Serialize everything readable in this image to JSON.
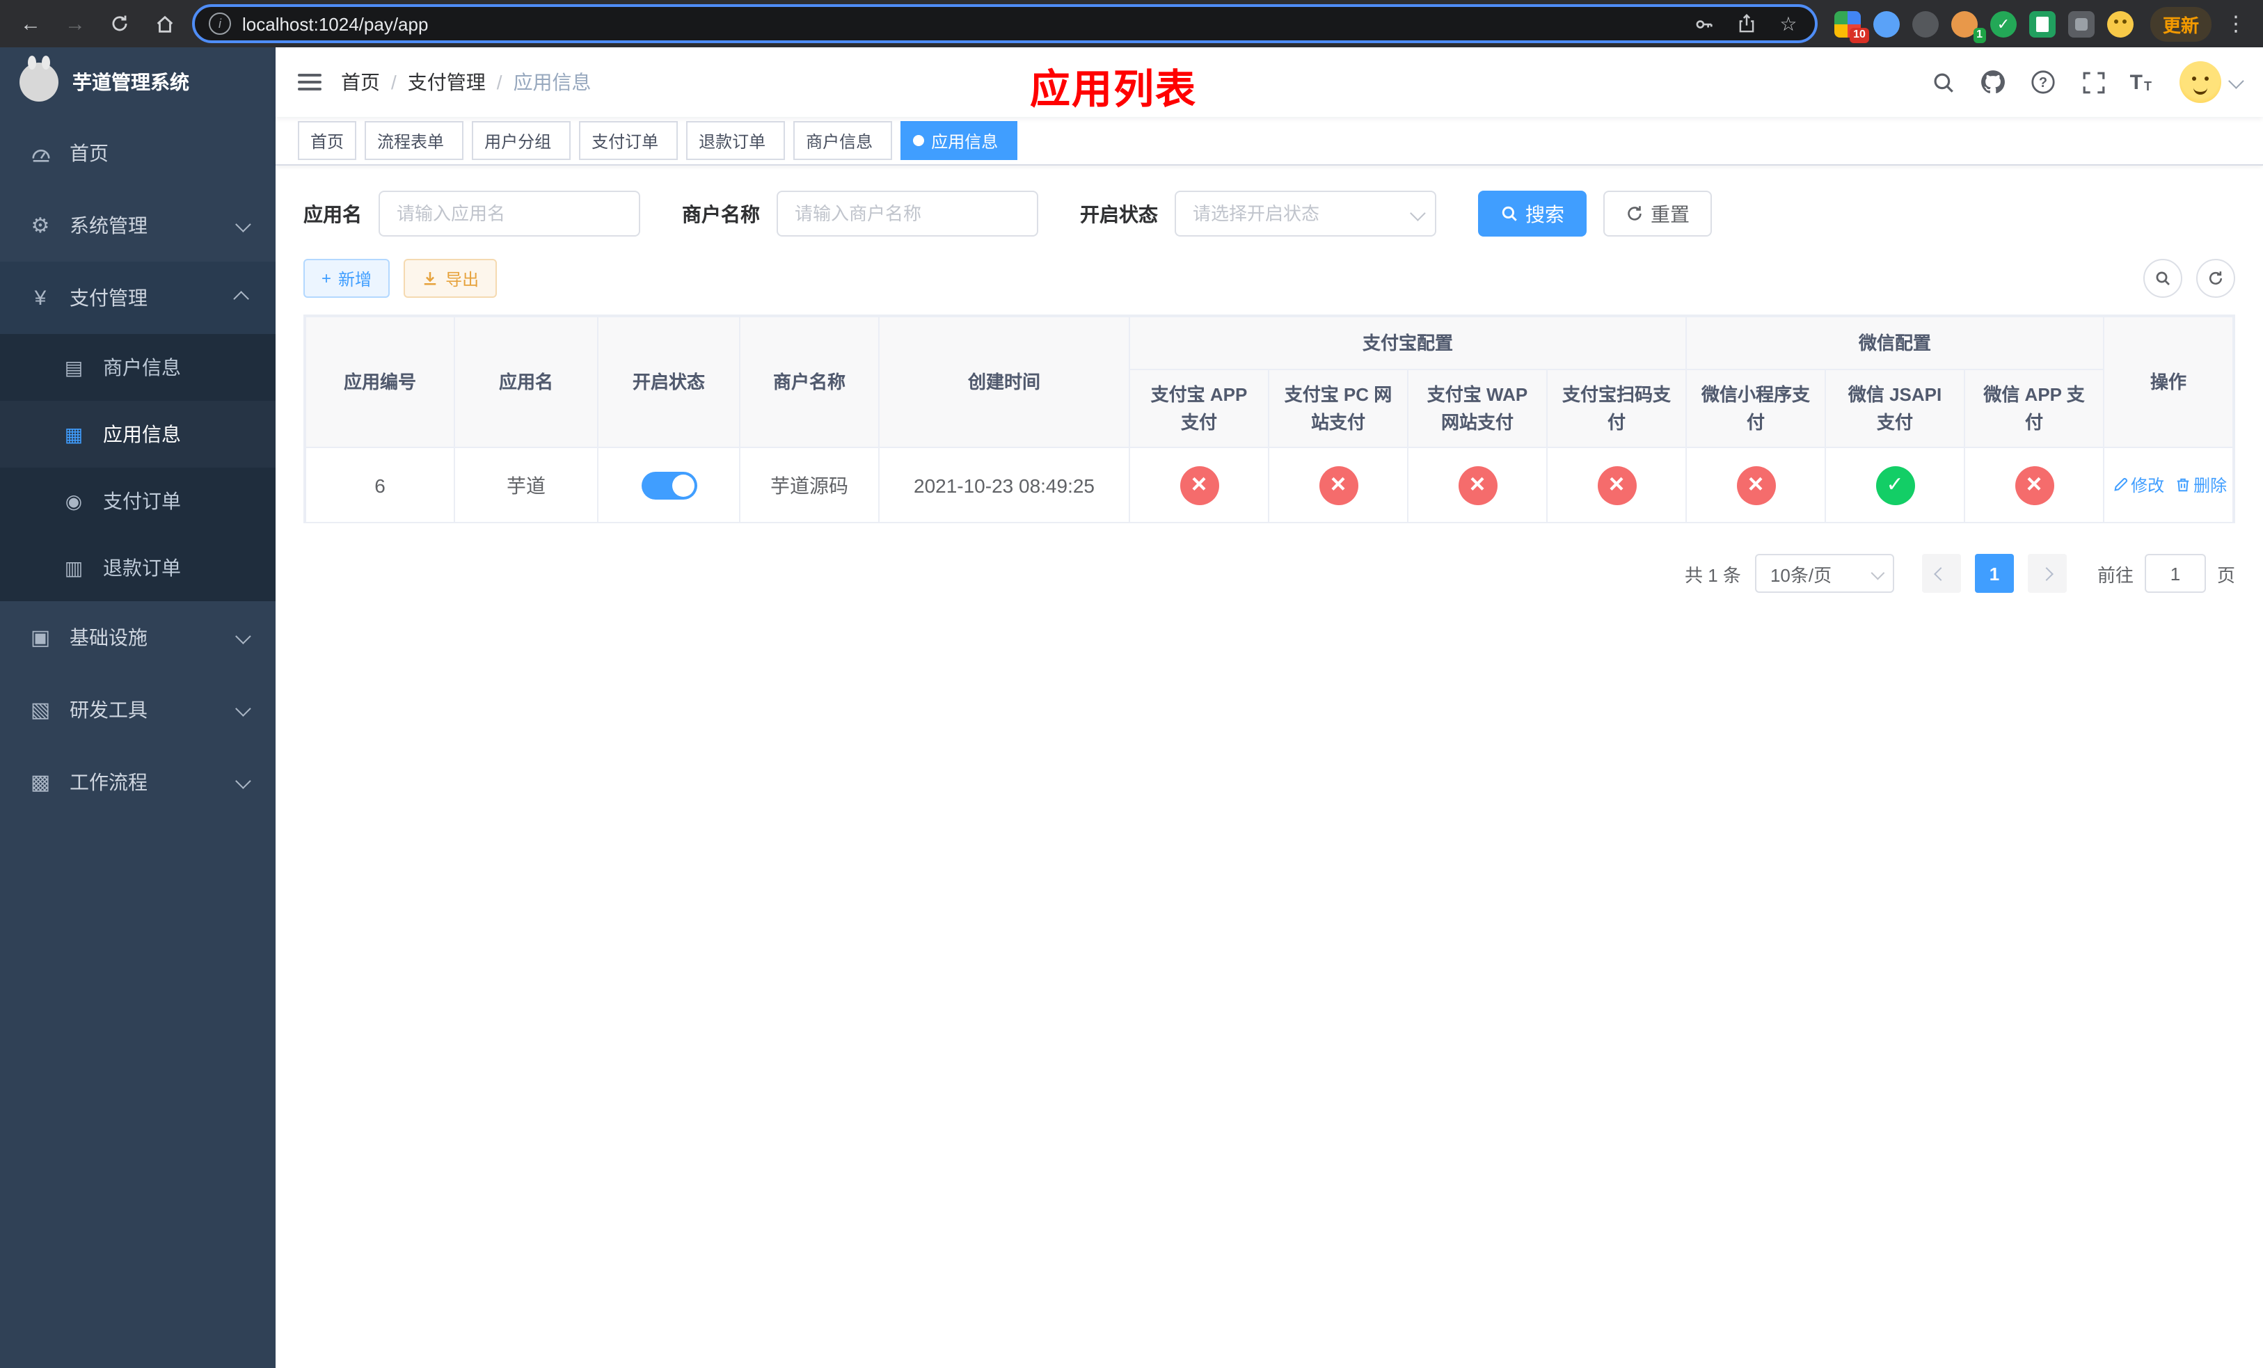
{
  "browser": {
    "url": "localhost:1024/pay/app",
    "update_label": "更新",
    "ext_badge_1": "10",
    "ext_badge_2": "1"
  },
  "icons": {
    "back_arrow": "←",
    "forward_arrow": "→",
    "star": "☆",
    "info": "i",
    "dots_vertical": "⋮",
    "gear": "⚙",
    "yen": "¥",
    "card": "▤",
    "grid": "▦",
    "order": "◉",
    "refund": "▥",
    "infra": "▣",
    "devtool": "▧",
    "workflow": "▩",
    "plus": "+",
    "check_ext": "✓",
    "font_size_big": "T",
    "font_size_small": "T"
  },
  "sidebar": {
    "title": "芋道管理系统",
    "items": [
      {
        "label": "首页"
      },
      {
        "label": "系统管理"
      },
      {
        "label": "支付管理"
      },
      {
        "label": "基础设施"
      },
      {
        "label": "研发工具"
      },
      {
        "label": "工作流程"
      }
    ],
    "payment_children": [
      {
        "label": "商户信息"
      },
      {
        "label": "应用信息"
      },
      {
        "label": "支付订单"
      },
      {
        "label": "退款订单"
      }
    ]
  },
  "header": {
    "breadcrumb": [
      "首页",
      "支付管理",
      "应用信息"
    ],
    "breadcrumb_sep": "/",
    "title": "应用列表"
  },
  "tabs": [
    {
      "label": "首页"
    },
    {
      "label": "流程表单"
    },
    {
      "label": "用户分组"
    },
    {
      "label": "支付订单"
    },
    {
      "label": "退款订单"
    },
    {
      "label": "商户信息"
    },
    {
      "label": "应用信息"
    }
  ],
  "filter": {
    "app_name_label": "应用名",
    "app_name_placeholder": "请输入应用名",
    "merchant_label": "商户名称",
    "merchant_placeholder": "请输入商户名称",
    "status_label": "开启状态",
    "status_placeholder": "请选择开启状态",
    "search_label": "搜索",
    "reset_label": "重置"
  },
  "toolbar": {
    "add_label": "新增",
    "export_label": "导出"
  },
  "table": {
    "group_headers": {
      "alipay": "支付宝配置",
      "wechat": "微信配置"
    },
    "headers": {
      "id": "应用编号",
      "name": "应用名",
      "status": "开启状态",
      "merchant": "商户名称",
      "created": "创建时间",
      "actions": "操作"
    },
    "sub_headers": [
      "支付宝 APP 支付",
      "支付宝 PC 网站支付",
      "支付宝 WAP 网站支付",
      "支付宝扫码支付",
      "微信小程序支付",
      "微信 JSAPI 支付",
      "微信 APP 支付"
    ],
    "rows": [
      {
        "id": "6",
        "name": "芋道",
        "status": "on",
        "merchant": "芋道源码",
        "created": "2021-10-23 08:49:25",
        "configs": [
          "fail",
          "fail",
          "fail",
          "fail",
          "fail",
          "success",
          "fail"
        ],
        "edit_label": "修改",
        "delete_label": "删除"
      }
    ]
  },
  "pagination": {
    "total": "共 1 条",
    "page_size": "10条/页",
    "current": "1",
    "goto_label": "前往",
    "goto_value": "1",
    "unit_label": "页"
  },
  "colors": {
    "primary": "#409eff",
    "success": "#13ce66",
    "danger": "#f56c6c",
    "warning": "#e6a23c",
    "title_red": "#ff0000",
    "sidebar_bg": "#304156",
    "submenu_bg": "#1f2d3d"
  }
}
